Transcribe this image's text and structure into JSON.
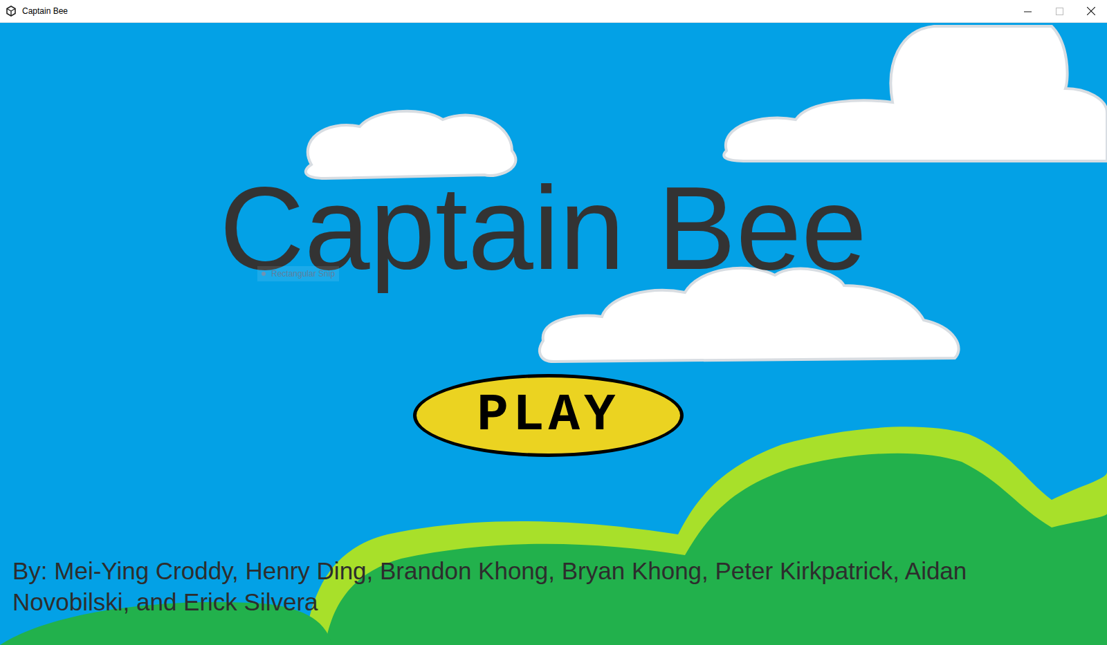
{
  "window": {
    "title": "Captain Bee"
  },
  "game": {
    "title": "Captain Bee",
    "play_button": "PLAY",
    "credits": "By: Mei-Ying Croddy, Henry Ding, Brandon Khong, Bryan Khong, Peter Kirkpatrick, Aidan Novobilski, and Erick Silvera"
  },
  "overlay": {
    "tooltip": "Rectangular Snip"
  }
}
